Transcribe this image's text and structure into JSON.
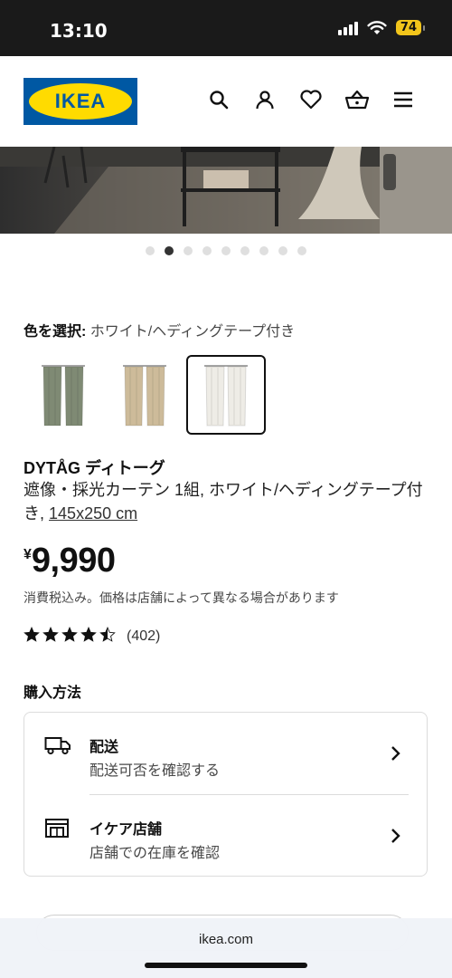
{
  "status_bar": {
    "time": "13:10",
    "battery": "74"
  },
  "header": {
    "logo_text": "IKEA",
    "icons": [
      "search-icon",
      "profile-icon",
      "heart-icon",
      "cart-icon",
      "menu-icon"
    ]
  },
  "gallery": {
    "dot_count": 9,
    "active_dot": 1
  },
  "color_picker": {
    "label": "色を選択:",
    "value": "ホワイト/ヘディングテープ付き",
    "swatches": [
      {
        "name": "green",
        "color": "#7f8a74"
      },
      {
        "name": "beige",
        "color": "#cdbb9a"
      },
      {
        "name": "white",
        "color": "#eeece6",
        "selected": true
      }
    ]
  },
  "product": {
    "name": "DYTÅG ディトーグ",
    "description": "遮像・採光カーテン 1組, ホワイト/ヘディングテープ付き,",
    "size": "145x250 cm",
    "currency": "¥",
    "price": "9,990",
    "tax_note": "消費税込み。価格は店舗によって異なる場合があります",
    "rating": 4.5,
    "review_count": "(402)"
  },
  "purchase": {
    "title": "購入方法",
    "options": [
      {
        "title": "配送",
        "subtitle": "配送可否を確認する",
        "icon": "truck-icon"
      },
      {
        "title": "イケア店舗",
        "subtitle": "店舗での在庫を確認",
        "icon": "store-icon"
      }
    ]
  },
  "browser": {
    "url": "ikea.com"
  },
  "colors": {
    "ikea_blue": "#0058a3",
    "ikea_yellow": "#ffdb00"
  }
}
